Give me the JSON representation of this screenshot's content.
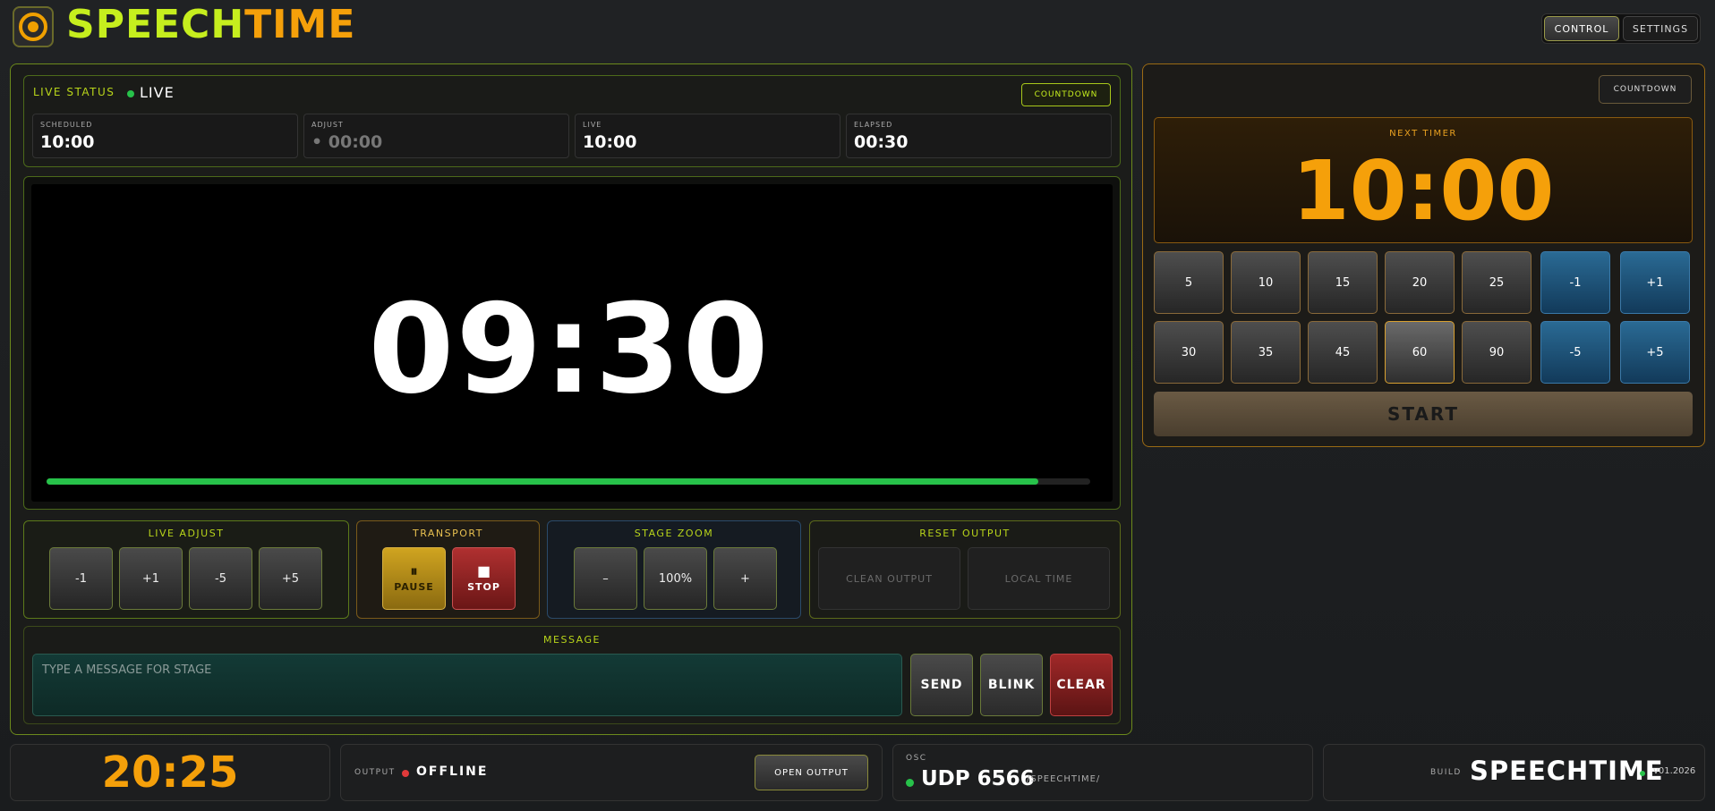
{
  "app": {
    "brand_part1": "SPEECH",
    "brand_part2": "TIME",
    "colors": {
      "accent_green": "#c6ee1e",
      "accent_orange": "#f5a00a",
      "live_green": "#27c24a",
      "offline_red": "#e03a3a"
    }
  },
  "header": {
    "tabs": [
      {
        "label": "CONTROL",
        "active": true
      },
      {
        "label": "SETTINGS",
        "active": false
      }
    ]
  },
  "status": {
    "label": "LIVE STATUS",
    "state": "LIVE",
    "mode_tag": "COUNTDOWN",
    "stats": [
      {
        "label": "SCHEDULED",
        "value": "10:00"
      },
      {
        "label": "ADJUST",
        "value": "• 00:00"
      },
      {
        "label": "LIVE",
        "value": "10:00"
      },
      {
        "label": "ELAPSED",
        "value": "00:30"
      }
    ]
  },
  "stage": {
    "time": "09:30",
    "progress": 0.95
  },
  "live_adjust": {
    "title": "LIVE ADJUST",
    "buttons": [
      "-1",
      "+1",
      "-5",
      "+5"
    ]
  },
  "transport": {
    "title": "TRANSPORT",
    "pause_icon": "⏸",
    "pause_label": "PAUSE",
    "stop_icon": "■",
    "stop_label": "STOP"
  },
  "stage_zoom": {
    "title": "STAGE ZOOM",
    "minus": "–",
    "value": "100%",
    "plus": "+"
  },
  "reset_output": {
    "title": "RESET OUTPUT",
    "clean": "CLEAN OUTPUT",
    "local": "LOCAL TIME"
  },
  "message": {
    "title": "MESSAGE",
    "placeholder": "TYPE A MESSAGE FOR STAGE",
    "send": "SEND",
    "blink": "BLINK",
    "clear": "CLEAR"
  },
  "next_timer": {
    "mode_button": "COUNTDOWN",
    "label": "NEXT TIMER",
    "value": "10:00",
    "presets_row1": [
      "5",
      "10",
      "15",
      "20",
      "25",
      "-1",
      "+1"
    ],
    "presets_row2": [
      "30",
      "35",
      "45",
      "60",
      "90",
      "-5",
      "+5"
    ],
    "selected": "60",
    "start": "START"
  },
  "footer": {
    "clock": "20:25",
    "output_label": "OUTPUT",
    "output_state": "OFFLINE",
    "open_output": "OPEN OUTPUT",
    "osc_label": "OSC",
    "osc_value": "UDP 6566",
    "osc_path": "/SPEECHTIME/",
    "build_label": "BUILD",
    "build_name": "SPEECHTIME",
    "build_version": "v01.2026"
  }
}
